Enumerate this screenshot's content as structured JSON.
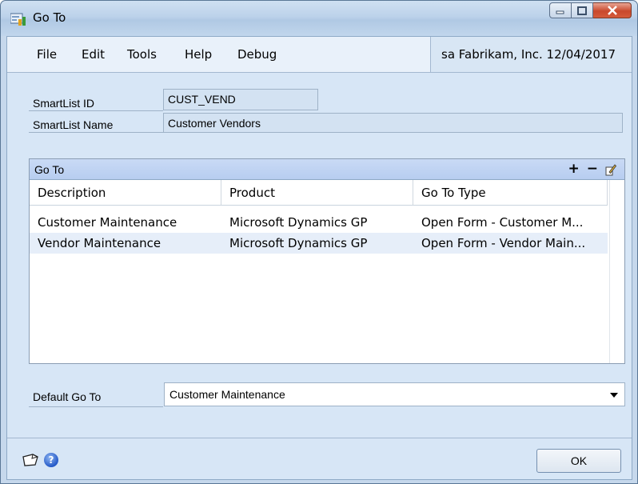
{
  "window": {
    "title": "Go To"
  },
  "menu": {
    "items": [
      "File",
      "Edit",
      "Tools",
      "Help",
      "Debug"
    ],
    "user_info": "sa  Fabrikam, Inc. 12/04/2017"
  },
  "fields": {
    "smartlist_id_label": "SmartList ID",
    "smartlist_id_value": "CUST_VEND",
    "smartlist_name_label": "SmartList Name",
    "smartlist_name_value": "Customer Vendors"
  },
  "goto_grid": {
    "title": "Go To",
    "tools": {
      "add": "+",
      "remove": "−",
      "edit": "edit-icon"
    },
    "columns": [
      "Description",
      "Product",
      "Go To Type"
    ],
    "rows": [
      {
        "description": "Customer Maintenance",
        "product": "Microsoft Dynamics GP",
        "goto_type": "Open Form - Customer M..."
      },
      {
        "description": "Vendor Maintenance",
        "product": "Microsoft Dynamics GP",
        "goto_type": "Open Form - Vendor Main..."
      }
    ],
    "selected_row": 1
  },
  "default_goto": {
    "label": "Default Go To",
    "value": "Customer Maintenance"
  },
  "footer": {
    "note_icon": "note-icon",
    "help_icon": "help-icon",
    "ok_label": "OK"
  }
}
